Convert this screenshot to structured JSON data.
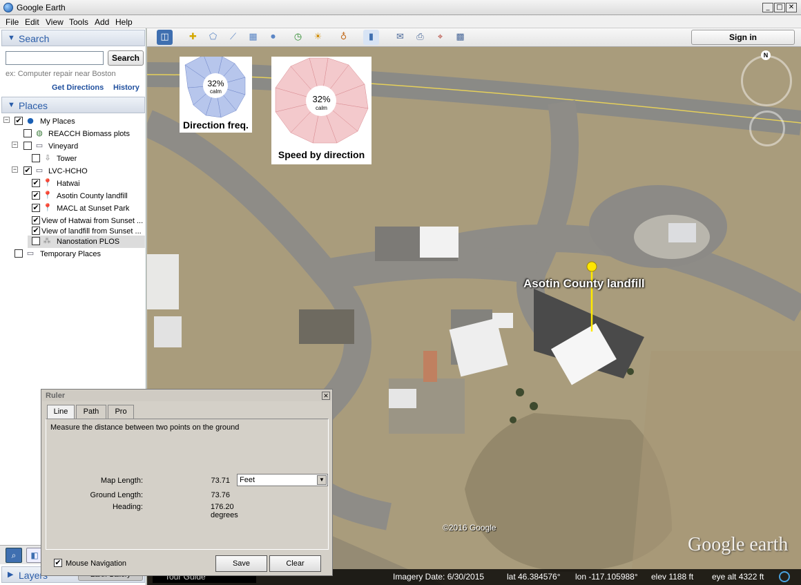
{
  "window": {
    "title": "Google Earth"
  },
  "menu": [
    "File",
    "Edit",
    "View",
    "Tools",
    "Add",
    "Help"
  ],
  "search": {
    "header": "Search",
    "input_value": "",
    "button": "Search",
    "hint": "ex: Computer repair near Boston",
    "get_directions": "Get Directions",
    "history": "History"
  },
  "places": {
    "header": "Places",
    "items": [
      {
        "label": "My Places",
        "checked": "✔",
        "icon": "globe-icon"
      },
      {
        "label": "REACCH Biomass plots",
        "checked": "",
        "icon": "network-link-icon"
      },
      {
        "label": "Vineyard",
        "checked": "",
        "icon": "folder-icon"
      },
      {
        "label": "Tower",
        "checked": "",
        "icon": "tower-icon"
      },
      {
        "label": "LVC-HCHO",
        "checked": "✔",
        "icon": "folder-icon"
      },
      {
        "label": "Hatwai",
        "checked": "✔",
        "icon": "pushpin-icon"
      },
      {
        "label": "Asotin County landfill",
        "checked": "✔",
        "icon": "pushpin-icon"
      },
      {
        "label": "MACL at Sunset Park",
        "checked": "✔",
        "icon": "pushpin-icon"
      },
      {
        "label": "View of Hatwai from Sunset ...",
        "checked": "✔",
        "icon": ""
      },
      {
        "label": "View of landfill from Sunset ...",
        "checked": "✔",
        "icon": ""
      },
      {
        "label": "Nanostation PLOS",
        "checked": "",
        "icon": "network-icon"
      },
      {
        "label": "Temporary Places",
        "checked": "",
        "icon": "folder-icon"
      }
    ]
  },
  "layers": {
    "header": "Layers",
    "gallery": "Earth Gallery",
    "tour": "Tour Guide"
  },
  "toolbar": {
    "signin": "Sign in"
  },
  "map": {
    "rose1": {
      "percent": "32%",
      "calm": "calm",
      "label": "Direction freq."
    },
    "rose2": {
      "percent": "32%",
      "calm": "calm",
      "label": "Speed by direction"
    },
    "placemark": "Asotin County landfill",
    "copyright": "©2016 Google",
    "logo": "Google earth",
    "compass_n": "N"
  },
  "status": {
    "imagery_date": "Imagery Date: 6/30/2015",
    "lat": "lat   46.384576°",
    "lon": "lon -117.105988°",
    "elev": "elev  1188 ft",
    "eye_alt": "eye alt   4322 ft"
  },
  "ruler": {
    "title": "Ruler",
    "tabs": [
      "Line",
      "Path",
      "Pro"
    ],
    "description": "Measure the distance between two points on the ground",
    "map_length_label": "Map Length:",
    "map_length_value": "73.71",
    "units": "Feet",
    "ground_length_label": "Ground Length:",
    "ground_length_value": "73.76",
    "heading_label": "Heading:",
    "heading_value": "176.20 degrees",
    "mouse_nav": "Mouse Navigation",
    "save": "Save",
    "clear": "Clear"
  }
}
